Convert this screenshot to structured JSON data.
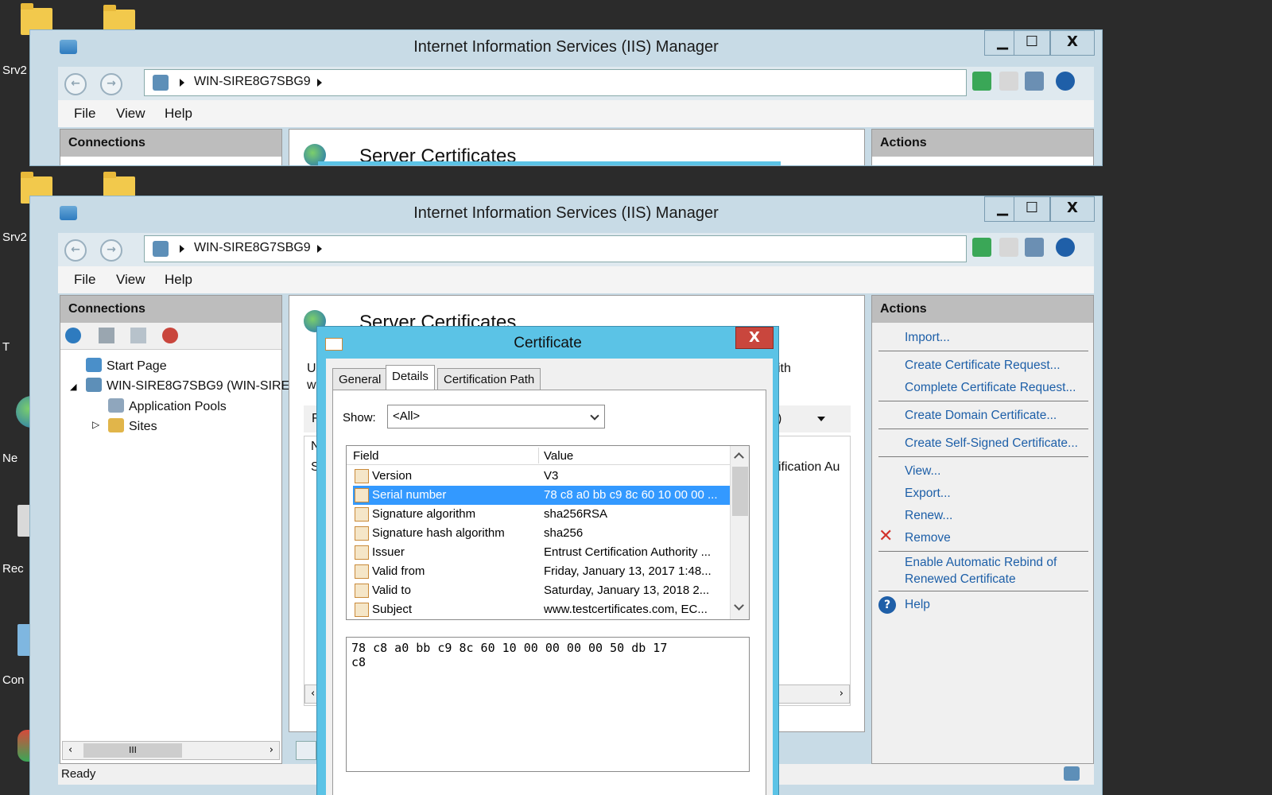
{
  "desktop": {
    "labels": [
      "Srv2",
      "Srv2",
      "T",
      "Ne",
      "Rec",
      "Con"
    ]
  },
  "window": {
    "title": "Internet Information Services (IIS) Manager",
    "minimize": "▁",
    "maximize": "☐",
    "close": "X"
  },
  "nav": {
    "path_server": "WIN-SIRE8G7SBG9"
  },
  "menu": {
    "file": "File",
    "view": "View",
    "help": "Help"
  },
  "connections": {
    "header": "Connections",
    "tree": [
      {
        "label": "Start Page"
      },
      {
        "label": "WIN-SIRE8G7SBG9 (WIN-SIRE"
      },
      {
        "label": "Application Pools"
      },
      {
        "label": "Sites"
      }
    ],
    "hscroll_thumb": "III"
  },
  "center": {
    "title": "Server Certificates",
    "frag_us": "Us",
    "frag_w": "w",
    "frag_ith": "ith",
    "frag_f": "F",
    "frag_n": "N",
    "frag_s": "S",
    "frag_col": "ification Au",
    "frag_paren": ")"
  },
  "actions": {
    "header": "Actions",
    "items": [
      {
        "label": "Import..."
      },
      {
        "label": "Create Certificate Request..."
      },
      {
        "label": "Complete Certificate Request..."
      },
      {
        "label": "Create Domain Certificate..."
      },
      {
        "label": "Create Self-Signed Certificate..."
      },
      {
        "label": "View..."
      },
      {
        "label": "Export..."
      },
      {
        "label": "Renew..."
      },
      {
        "label": "Remove"
      },
      {
        "label": "Enable Automatic Rebind of"
      },
      {
        "label": "Renewed Certificate"
      },
      {
        "label": "Help"
      }
    ]
  },
  "dialog": {
    "title": "Certificate",
    "close": "X",
    "tabs": [
      "General",
      "Details",
      "Certification Path"
    ],
    "active_tab": "Details",
    "show_label": "Show:",
    "show_value": "<All>",
    "columns": {
      "field": "Field",
      "value": "Value"
    },
    "rows": [
      {
        "field": "Version",
        "value": "V3"
      },
      {
        "field": "Serial number",
        "value": "78 c8 a0 bb c9 8c 60 10 00 00 ..."
      },
      {
        "field": "Signature algorithm",
        "value": "sha256RSA"
      },
      {
        "field": "Signature hash algorithm",
        "value": "sha256"
      },
      {
        "field": "Issuer",
        "value": "Entrust Certification Authority ..."
      },
      {
        "field": "Valid from",
        "value": "Friday, January 13, 2017 1:48..."
      },
      {
        "field": "Valid to",
        "value": "Saturday, January 13, 2018 2..."
      },
      {
        "field": "Subject",
        "value": "www.testcertificates.com, EC..."
      }
    ],
    "selected_row": "Serial number",
    "detail_line1": "78 c8 a0 bb c9 8c 60 10 00 00 00 00 50 db 17",
    "detail_line2": "c8"
  },
  "status": {
    "text": "Ready"
  },
  "colors": {
    "window_chrome": "#c8dbe6",
    "dialog_chrome": "#5bc3e6",
    "selection": "#3399ff",
    "link": "#1d5fa8",
    "close_red": "#c9463d"
  }
}
